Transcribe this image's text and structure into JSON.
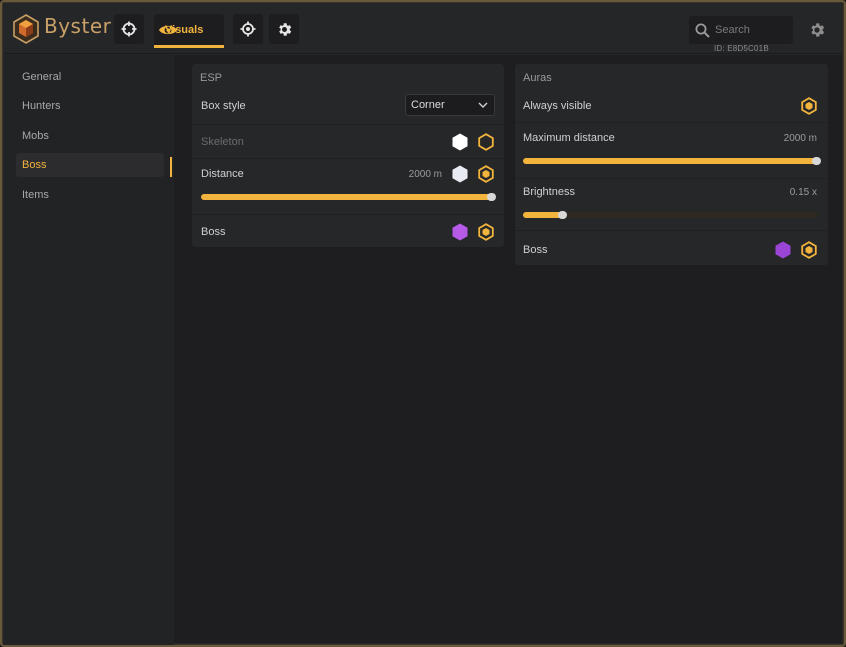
{
  "app": {
    "brand": "Byster",
    "colors": {
      "accent": "#f2b43d",
      "boss_color": "#a54de2",
      "white_color": "#ffffff",
      "skeleton_color": "#e8ecf2"
    }
  },
  "header": {
    "tabs": [
      {
        "name": "crosshair-tab",
        "icon": "crosshair-icon"
      },
      {
        "name": "visuals-tab",
        "label": "Visuals",
        "icon": "eye-icon",
        "active": true
      },
      {
        "name": "target-tab",
        "icon": "target-icon"
      },
      {
        "name": "settings-tab",
        "icon": "gear-icon"
      }
    ],
    "search": {
      "placeholder": "Search"
    },
    "id_text": "ID: E8D5C01B"
  },
  "sidebar": {
    "items": [
      {
        "label": "General"
      },
      {
        "label": "Hunters"
      },
      {
        "label": "Mobs"
      },
      {
        "label": "Boss",
        "active": true
      },
      {
        "label": "Items"
      }
    ]
  },
  "esp": {
    "title": "ESP",
    "box_style": {
      "label": "Box style",
      "value": "Corner"
    },
    "skeleton": {
      "label": "Skeleton"
    },
    "distance": {
      "label": "Distance",
      "value": "2000 m",
      "fraction": 1.0
    },
    "boss": {
      "label": "Boss"
    }
  },
  "auras": {
    "title": "Auras",
    "always_visible": {
      "label": "Always visible"
    },
    "max_distance": {
      "label": "Maximum distance",
      "value": "2000 m",
      "fraction": 1.0
    },
    "brightness": {
      "label": "Brightness",
      "value": "0.15 x",
      "fraction": 0.14
    },
    "boss": {
      "label": "Boss"
    }
  }
}
